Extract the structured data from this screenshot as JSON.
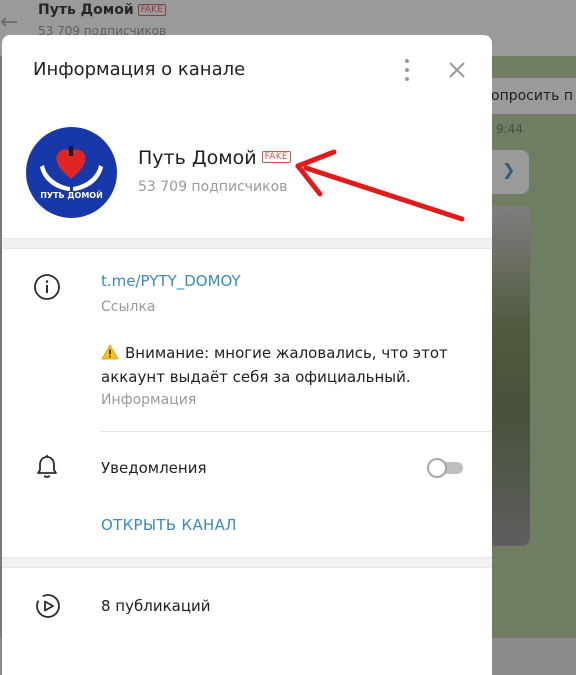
{
  "background": {
    "title": "Путь Домой",
    "fake_badge": "FAKE",
    "subscribers": "53 709 подписчиков",
    "ask_button": "опросить п",
    "time": "9:44"
  },
  "modal": {
    "title": "Информация о канале",
    "channel": {
      "name": "Путь Домой",
      "badge": "FAKE",
      "subscribers": "53 709 подписчиков",
      "avatar_text": "ПУТЬ ДОМОЙ"
    },
    "info": {
      "link": "t.me/PYTY_DOMOY",
      "link_label": "Ссылка",
      "warning": "Внимание: многие жаловались, что этот аккаунт выдаёт себя за официальный.",
      "warning_label": "Информация"
    },
    "notifications": {
      "label": "Уведомления",
      "enabled": false
    },
    "open_channel": "ОТКРЫТЬ КАНАЛ",
    "posts": "8 публикаций"
  },
  "colors": {
    "accent": "#3a8ac2",
    "fake_red": "#d9534f",
    "annotation_arrow": "#e11b1b",
    "avatar_blue": "#1738a8"
  },
  "icons": [
    "back-arrow-icon",
    "more-vertical-icon",
    "close-icon",
    "info-icon",
    "warning-icon",
    "bell-icon",
    "play-circle-icon",
    "red-arrow-annotation"
  ]
}
